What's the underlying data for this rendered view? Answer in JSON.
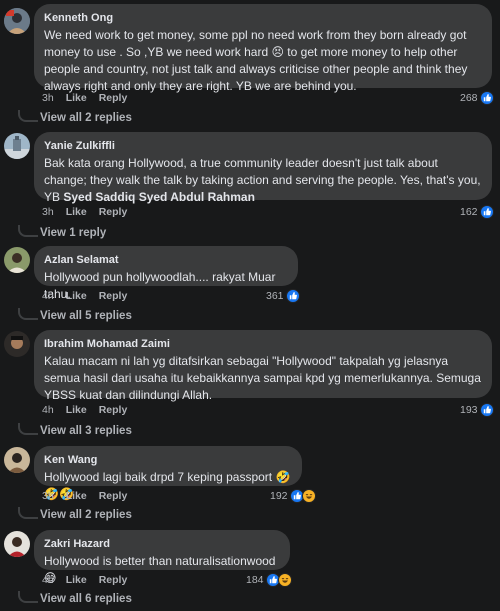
{
  "comments": [
    {
      "author": "Kenneth Ong",
      "text": "We need work to get money, some ppl no need work from they born already got money to use . So ,YB we need work hard 😣 to get more money to help other people and country, not just talk and always criticise other people and think they always right and only they are right. YB we are behind you.",
      "time": "3h",
      "like": "Like",
      "reply": "Reply",
      "reaction_count": "268",
      "view_replies": "View all 2 replies"
    },
    {
      "author": "Yanie Zulkiffli",
      "text_before": "Bak kata orang Hollywood, a true community leader doesn't just talk about change; they walk the talk by taking action and serving the people. Yes, that's you, YB ",
      "mention": "Syed Saddiq Syed Abdul Rahman",
      "time": "3h",
      "like": "Like",
      "reply": "Reply",
      "reaction_count": "162",
      "view_replies": "View 1 reply"
    },
    {
      "author": "Azlan Selamat",
      "text": "Hollywood pun hollywoodlah.... rakyat Muar tahu.",
      "time": "4h",
      "like": "Like",
      "reply": "Reply",
      "reaction_count": "361",
      "view_replies": "View all 5 replies"
    },
    {
      "author": "Ibrahim Mohamad Zaimi",
      "text": "Kalau macam ni lah yg ditafsirkan sebagai \"Hollywood\" takpalah yg jelasnya semua hasil dari usaha itu kebaikkannya sampai kpd yg memerlukannya. Semuga YBSS kuat dan dilindungi Allah.",
      "time": "4h",
      "like": "Like",
      "reply": "Reply",
      "reaction_count": "193",
      "view_replies": "View all 3 replies"
    },
    {
      "author": "Ken Wang",
      "text": "Hollywood lagi baik drpd 7 keping passport",
      "emoji_suffix": "🤣🤣🤣",
      "time": "3h",
      "like": "Like",
      "reply": "Reply",
      "reaction_count": "192",
      "view_replies": "View all 2 replies"
    },
    {
      "author": "Zakri Hazard",
      "text": "Hollywood is better than naturalisationwood",
      "emoji_suffix": "😅",
      "time": "4h",
      "like": "Like",
      "reply": "Reply",
      "reaction_count": "184",
      "view_replies": "View all 6 replies"
    }
  ],
  "icons": {
    "like": "like-reaction-icon",
    "haha": "haha-reaction-icon",
    "reply_arrow": "reply-thread-icon"
  },
  "colors": {
    "background": "#18191a",
    "bubble": "#3a3b3c",
    "text": "#e4e6eb",
    "muted": "#b0b3b8",
    "like_blue": "#1877f2"
  }
}
